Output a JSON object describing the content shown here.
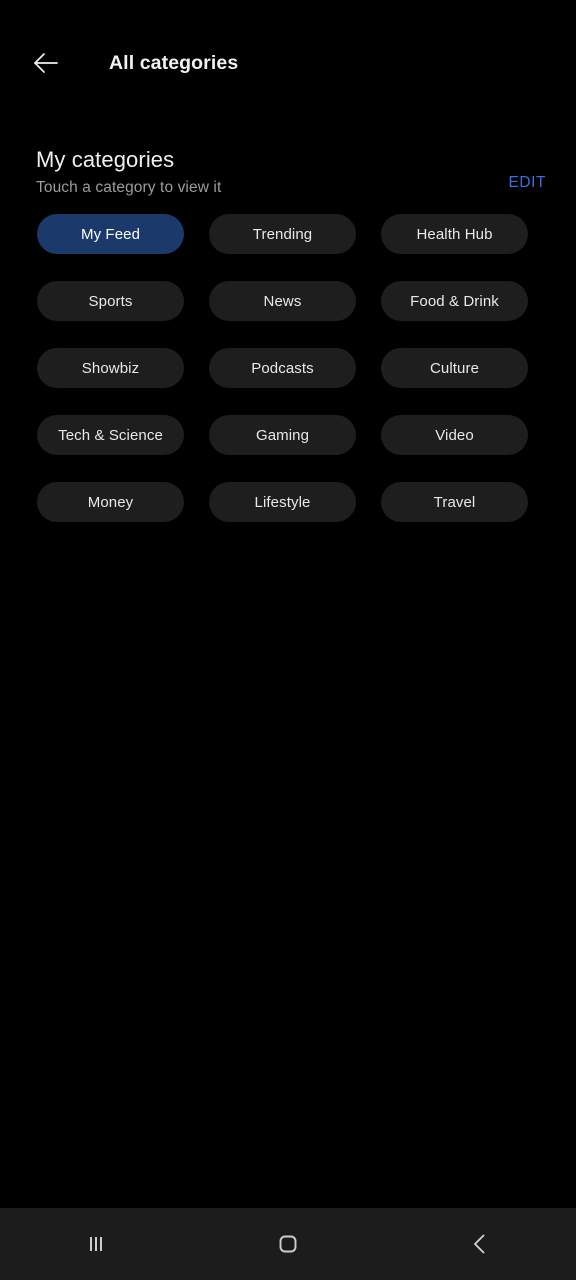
{
  "appbar": {
    "back_icon": "arrow-left-icon",
    "title": "All categories"
  },
  "section": {
    "title": "My categories",
    "subtitle": "Touch a category to view it",
    "edit_label": "EDIT"
  },
  "colors": {
    "background": "#000000",
    "chip_background": "#1e1e1e",
    "chip_selected_background": "#1b3a6b",
    "accent_edit": "#3f6fdd",
    "navbar_background": "#1c1c1c",
    "primary_text": "#f0f0f0",
    "secondary_text": "#9c9c9c"
  },
  "categories": [
    {
      "label": "My Feed",
      "selected": true
    },
    {
      "label": "Trending",
      "selected": false
    },
    {
      "label": "Health Hub",
      "selected": false
    },
    {
      "label": "Sports",
      "selected": false
    },
    {
      "label": "News",
      "selected": false
    },
    {
      "label": "Food & Drink",
      "selected": false
    },
    {
      "label": "Showbiz",
      "selected": false
    },
    {
      "label": "Podcasts",
      "selected": false
    },
    {
      "label": "Culture",
      "selected": false
    },
    {
      "label": "Tech & Science",
      "selected": false
    },
    {
      "label": "Gaming",
      "selected": false
    },
    {
      "label": "Video",
      "selected": false
    },
    {
      "label": "Money",
      "selected": false
    },
    {
      "label": "Lifestyle",
      "selected": false
    },
    {
      "label": "Travel",
      "selected": false
    }
  ],
  "navbar": {
    "recents_icon": "recents-icon",
    "home_icon": "home-icon",
    "back_icon": "chevron-left-icon"
  }
}
